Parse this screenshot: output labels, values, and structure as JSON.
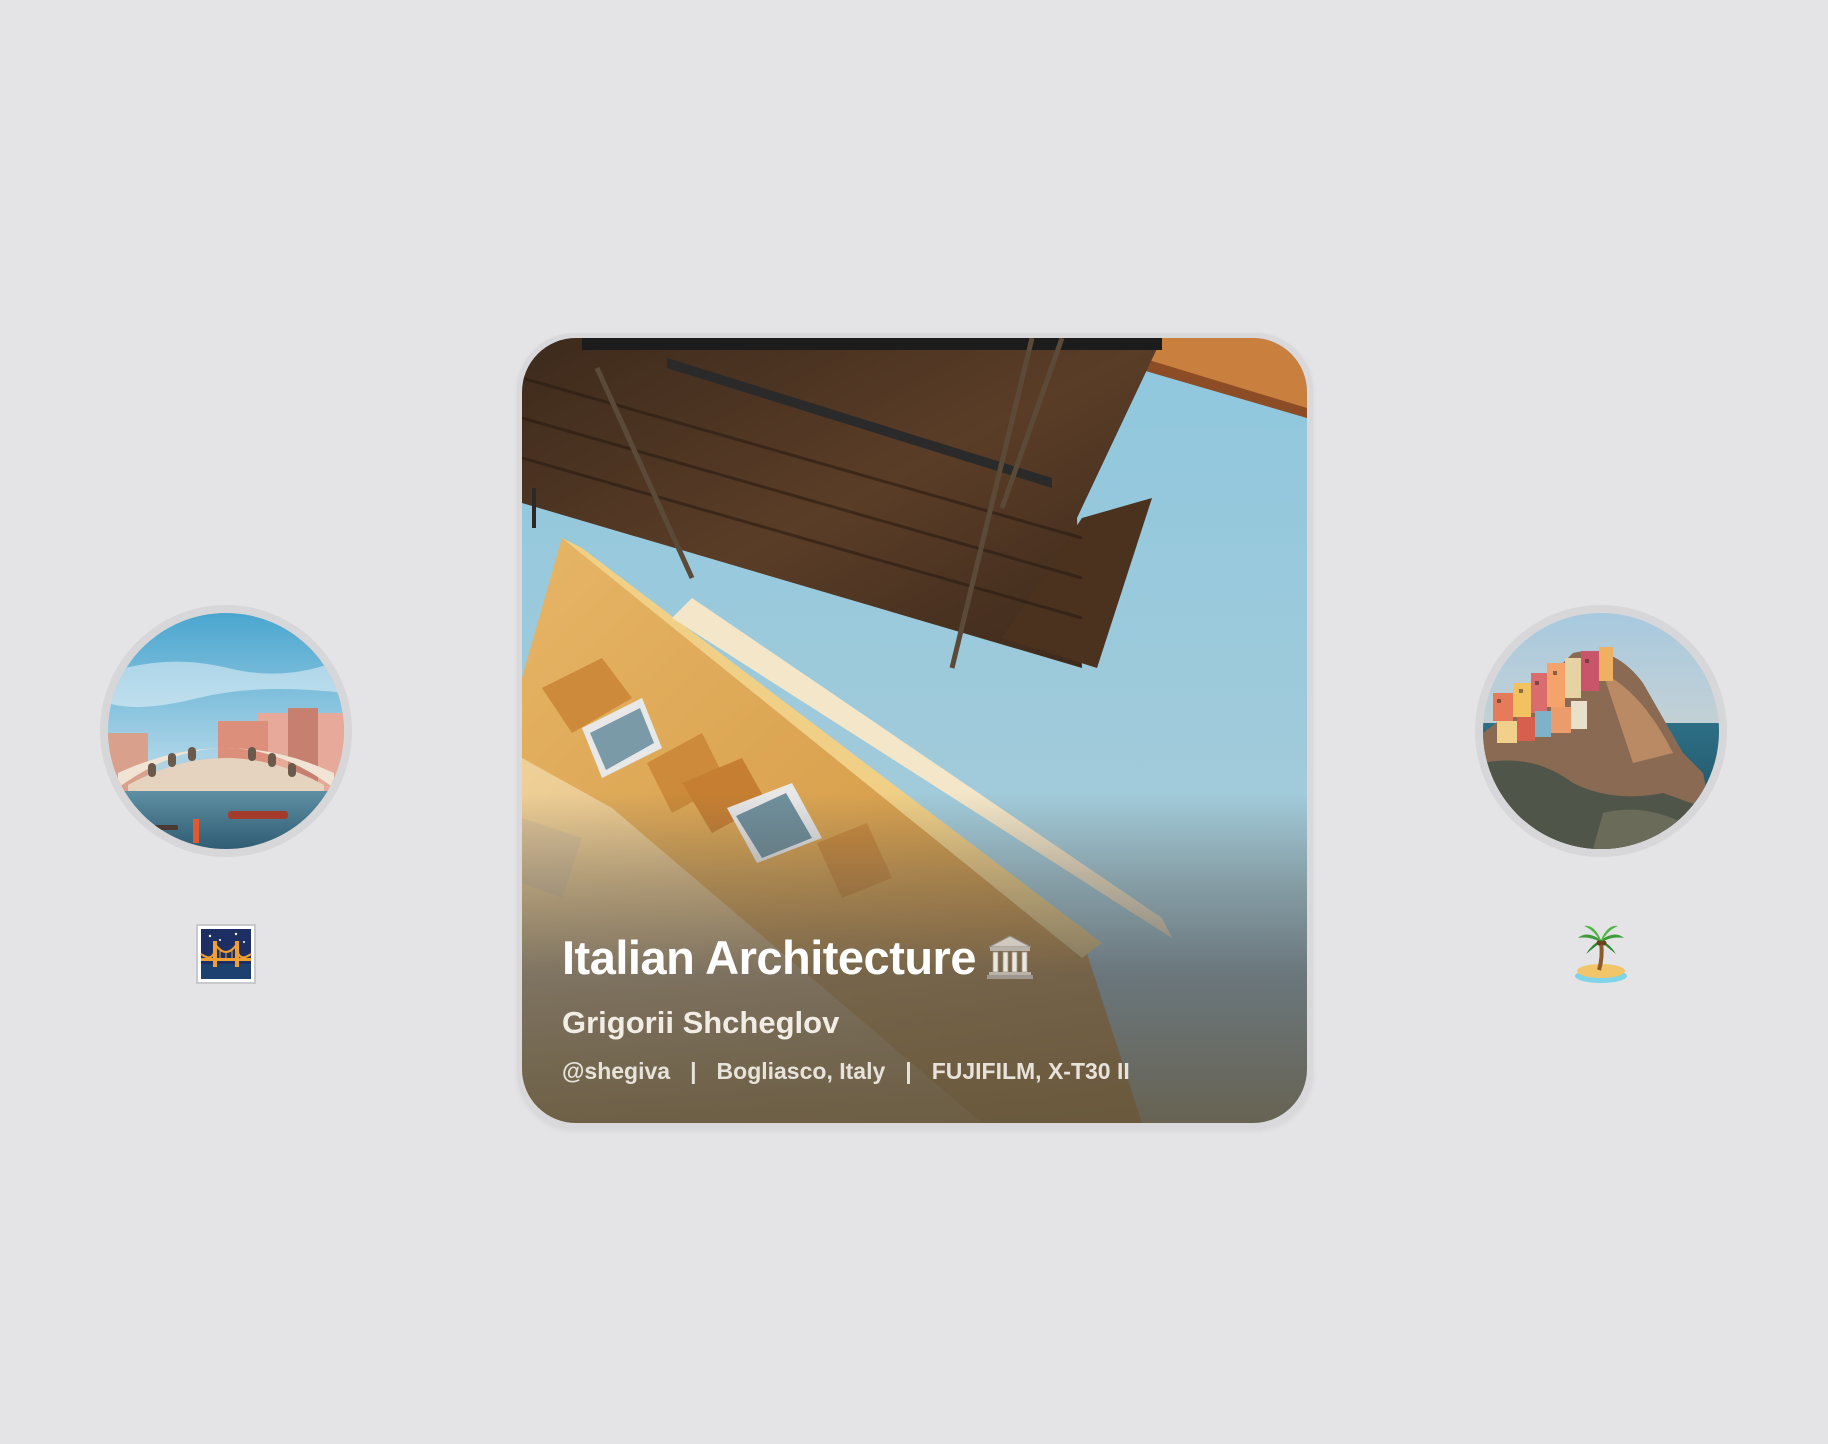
{
  "featured": {
    "title": "Italian Architecture",
    "title_icon": "classical-building-icon",
    "author": "Grigorii Shcheglov",
    "handle": "@shegiva",
    "location": "Bogliasco, Italy",
    "camera": "FUJIFILM, X-T30 II",
    "separator": "|"
  },
  "side_items": [
    {
      "position": "left",
      "image": "venice-rialto-bridge-photo",
      "icon": "bridge-at-night-icon"
    },
    {
      "position": "right",
      "image": "manarola-cinque-terre-photo",
      "icon": "desert-island-icon"
    }
  ],
  "colors": {
    "background": "#e4e4e6",
    "frame": "#d9d9dc",
    "text": "#ffffff"
  }
}
